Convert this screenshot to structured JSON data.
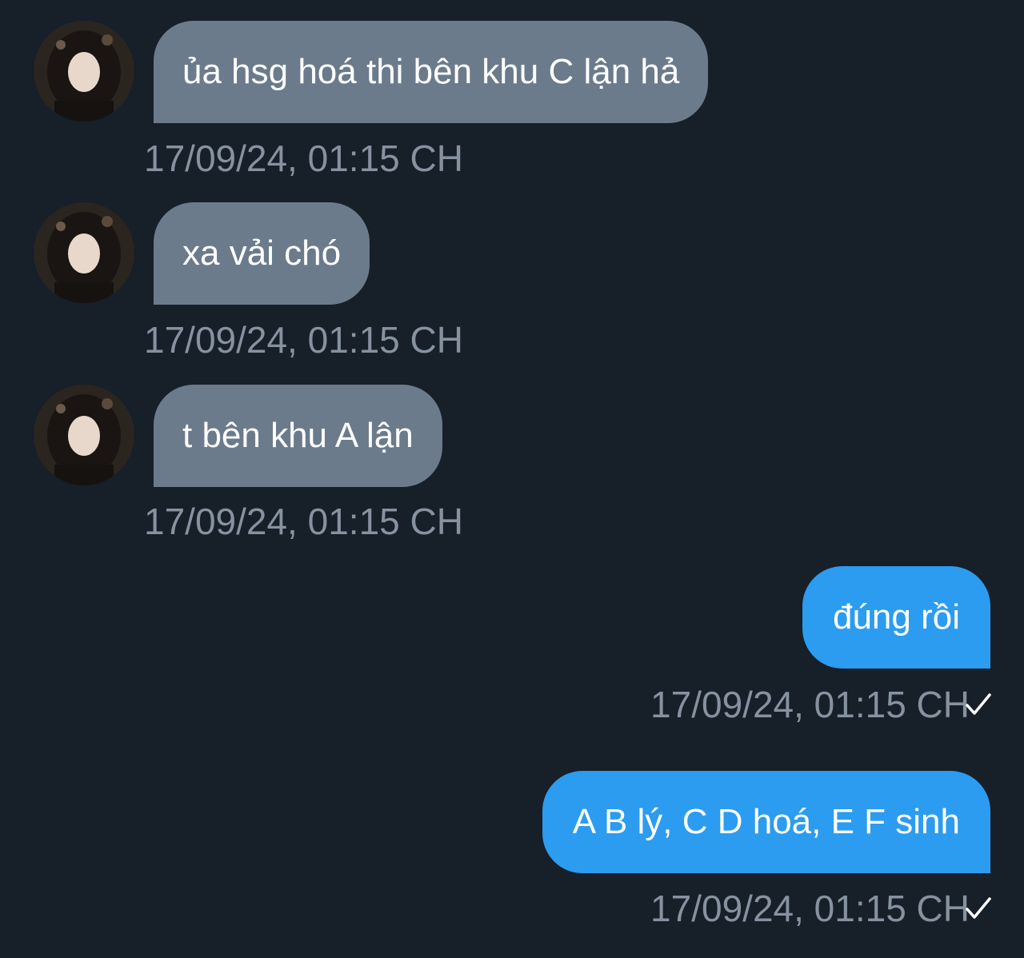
{
  "theme": {
    "background": "#171f29",
    "incoming_bubble": "#6b7b8c",
    "outgoing_bubble": "#2b9cf0",
    "bubble_text": "#ffffff",
    "timestamp_text": "#8692a0",
    "check_color": "#ffffff"
  },
  "messages": [
    {
      "direction": "incoming",
      "text": "ủa hsg hoá thi bên khu C lận hả",
      "time": "17/09/24, 01:15 CH",
      "avatar_icon": "contact-avatar"
    },
    {
      "direction": "incoming",
      "text": "xa vải chó",
      "time": "17/09/24, 01:15 CH",
      "avatar_icon": "contact-avatar"
    },
    {
      "direction": "incoming",
      "text": "t bên khu A lận",
      "time": "17/09/24, 01:15 CH",
      "avatar_icon": "contact-avatar"
    },
    {
      "direction": "outgoing",
      "text": "đúng rồi",
      "time": "17/09/24, 01:15 CH",
      "status_icon": "check-icon"
    },
    {
      "direction": "outgoing",
      "text": "A B lý, C D hoá, E F sinh",
      "time": "17/09/24, 01:15 CH",
      "status_icon": "check-icon"
    }
  ]
}
